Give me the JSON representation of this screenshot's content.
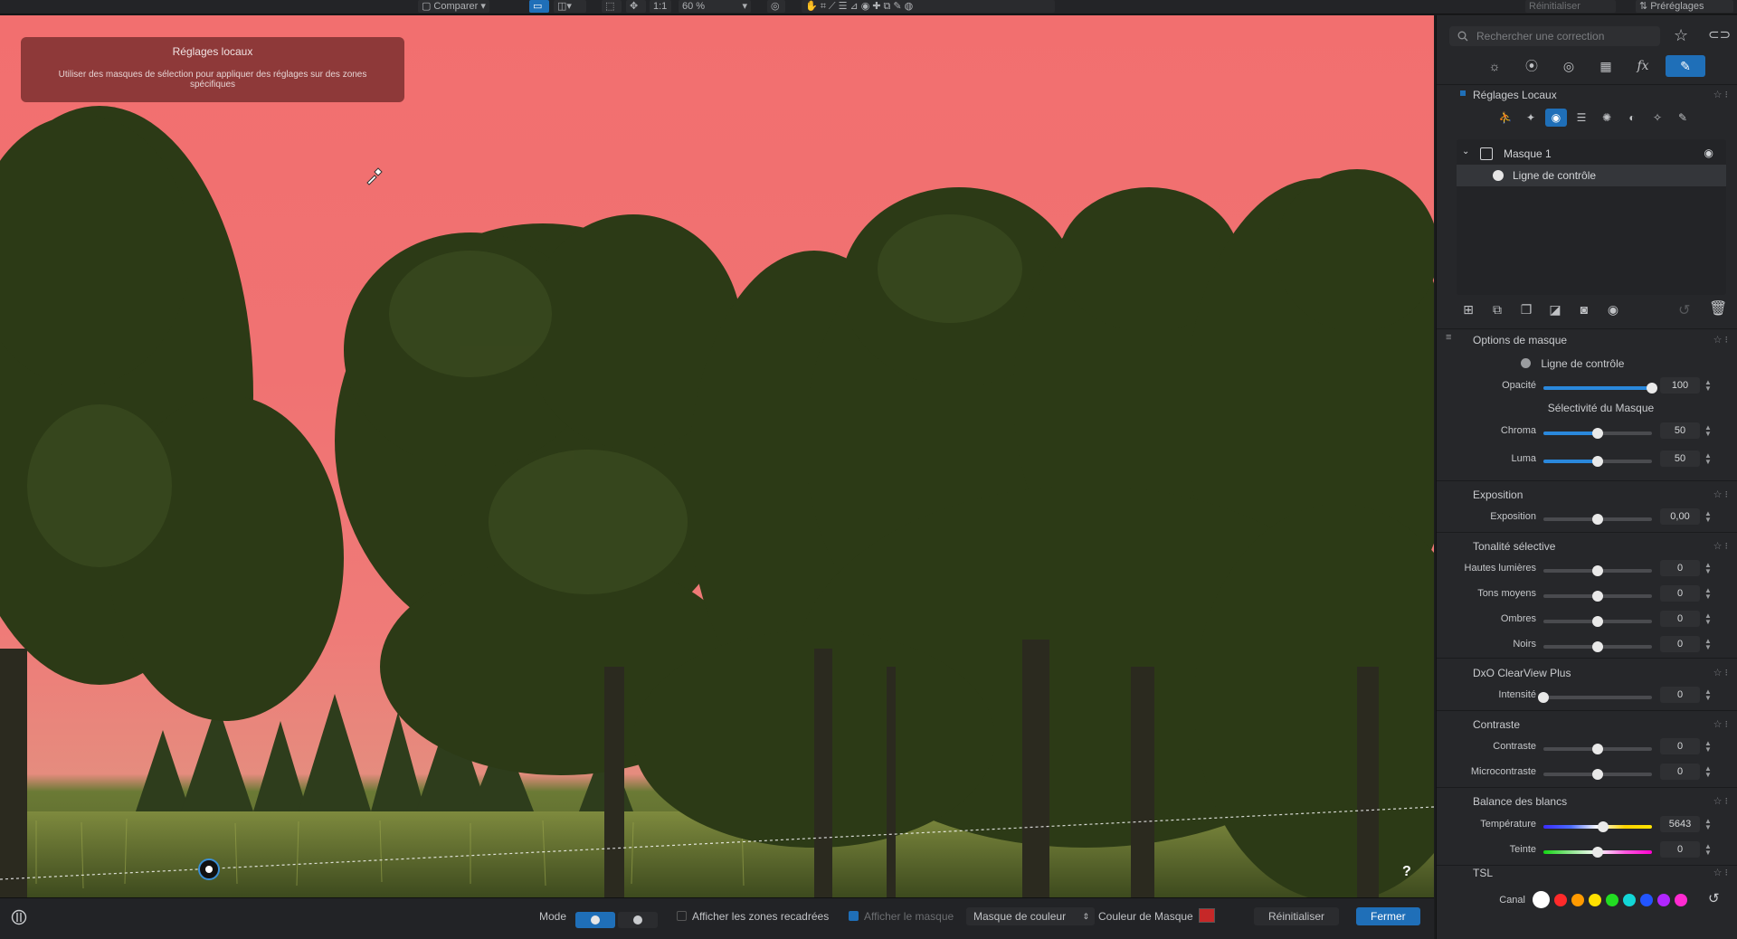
{
  "topbar": {
    "compare_label": "Comparer",
    "zoom_label": "1:1",
    "zoom_value": "60 %",
    "reset_label": "Réinitialiser",
    "presets_label": "Préréglages"
  },
  "canvas": {
    "tooltip_title": "Réglages locaux",
    "tooltip_text": "Utiliser des masques de sélection pour appliquer des réglages sur des zones spécifiques",
    "help_label": "?",
    "mask_color": "#f26f6f"
  },
  "bottombar": {
    "mode_label": "Mode",
    "show_cropped_label": "Afficher les zones recadrées",
    "show_mask_label": "Afficher le masque",
    "mask_type_value": "Masque de couleur",
    "mask_color_label": "Couleur de Masque",
    "mask_color_swatch": "#c62828",
    "reset_label": "Réinitialiser",
    "close_label": "Fermer"
  },
  "panel": {
    "search_placeholder": "Rechercher une correction",
    "local_adjust_title": "Réglages Locaux",
    "mask_name": "Masque 1",
    "mask_child": "Ligne de contrôle",
    "options_title": "Options de masque",
    "options_tool": "Ligne de contrôle",
    "opacity": {
      "label": "Opacité",
      "value": "100",
      "pos": 1.0
    },
    "selectivity_title": "Sélectivité du Masque",
    "chroma": {
      "label": "Chroma",
      "value": "50",
      "pos": 0.5
    },
    "luma": {
      "label": "Luma",
      "value": "50",
      "pos": 0.5
    },
    "exposure_title": "Exposition",
    "exposure": {
      "label": "Exposition",
      "value": "0,00",
      "pos": 0.5
    },
    "tonal_title": "Tonalité sélective",
    "highlights": {
      "label": "Hautes lumières",
      "value": "0",
      "pos": 0.5
    },
    "midtones": {
      "label": "Tons moyens",
      "value": "0",
      "pos": 0.5
    },
    "shadows": {
      "label": "Ombres",
      "value": "0",
      "pos": 0.5
    },
    "blacks": {
      "label": "Noirs",
      "value": "0",
      "pos": 0.5
    },
    "clearview_title": "DxO ClearView Plus",
    "intensity": {
      "label": "Intensité",
      "value": "0",
      "pos": 0.0
    },
    "contrast_title": "Contraste",
    "contrast": {
      "label": "Contraste",
      "value": "0",
      "pos": 0.5
    },
    "microcontrast": {
      "label": "Microcontraste",
      "value": "0",
      "pos": 0.5
    },
    "wb_title": "Balance des blancs",
    "temperature": {
      "label": "Température",
      "value": "5643",
      "pos": 0.55
    },
    "tint": {
      "label": "Teinte",
      "value": "0",
      "pos": 0.5
    },
    "hsl_title": "TSL",
    "channel_label": "Canal",
    "channel_colors": [
      "#ffffff",
      "#ff2a2a",
      "#ff9a00",
      "#ffe000",
      "#22dd22",
      "#12d6d6",
      "#2255ff",
      "#b026ff",
      "#ff2ad0"
    ]
  }
}
